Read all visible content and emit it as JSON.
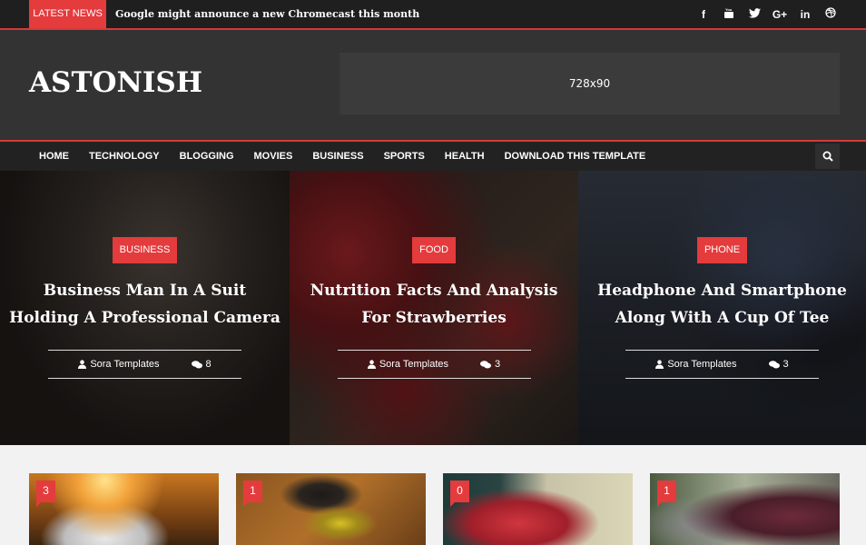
{
  "topbar": {
    "latest_label": "LATEST NEWS",
    "ticker_text": "Google might announce a new Chromecast this month",
    "social": [
      {
        "icon": "facebook-icon",
        "glyph": "f"
      },
      {
        "icon": "youtube-icon",
        "glyph": "▶"
      },
      {
        "icon": "twitter-icon",
        "glyph": "🐦"
      },
      {
        "icon": "google-plus-icon",
        "glyph": "G+"
      },
      {
        "icon": "linkedin-icon",
        "glyph": "in"
      },
      {
        "icon": "dribbble-icon",
        "glyph": "◎"
      }
    ]
  },
  "header": {
    "logo": "ASTONISH",
    "ad_label": "728x90"
  },
  "nav": {
    "items": [
      "HOME",
      "TECHNOLOGY",
      "BLOGGING",
      "MOVIES",
      "BUSINESS",
      "SPORTS",
      "HEALTH",
      "DOWNLOAD THIS TEMPLATE"
    ]
  },
  "hero": {
    "slides": [
      {
        "category": "BUSINESS",
        "title": "Business Man In A Suit Holding A Professional Camera",
        "author": "Sora Templates",
        "comments": "8"
      },
      {
        "category": "FOOD",
        "title": "Nutrition Facts And Analysis For Strawberries",
        "author": "Sora Templates",
        "comments": "3"
      },
      {
        "category": "PHONE",
        "title": "Headphone And Smartphone Along With A Cup Of Tee",
        "author": "Sora Templates",
        "comments": "3"
      }
    ]
  },
  "cards": [
    {
      "comments": "3"
    },
    {
      "comments": "1"
    },
    {
      "comments": "0"
    },
    {
      "comments": "1"
    }
  ],
  "colors": {
    "accent": "#e43b3d",
    "topbar_bg": "#1f1f1f",
    "header_bg": "#333333",
    "nav_bg": "#222222"
  }
}
